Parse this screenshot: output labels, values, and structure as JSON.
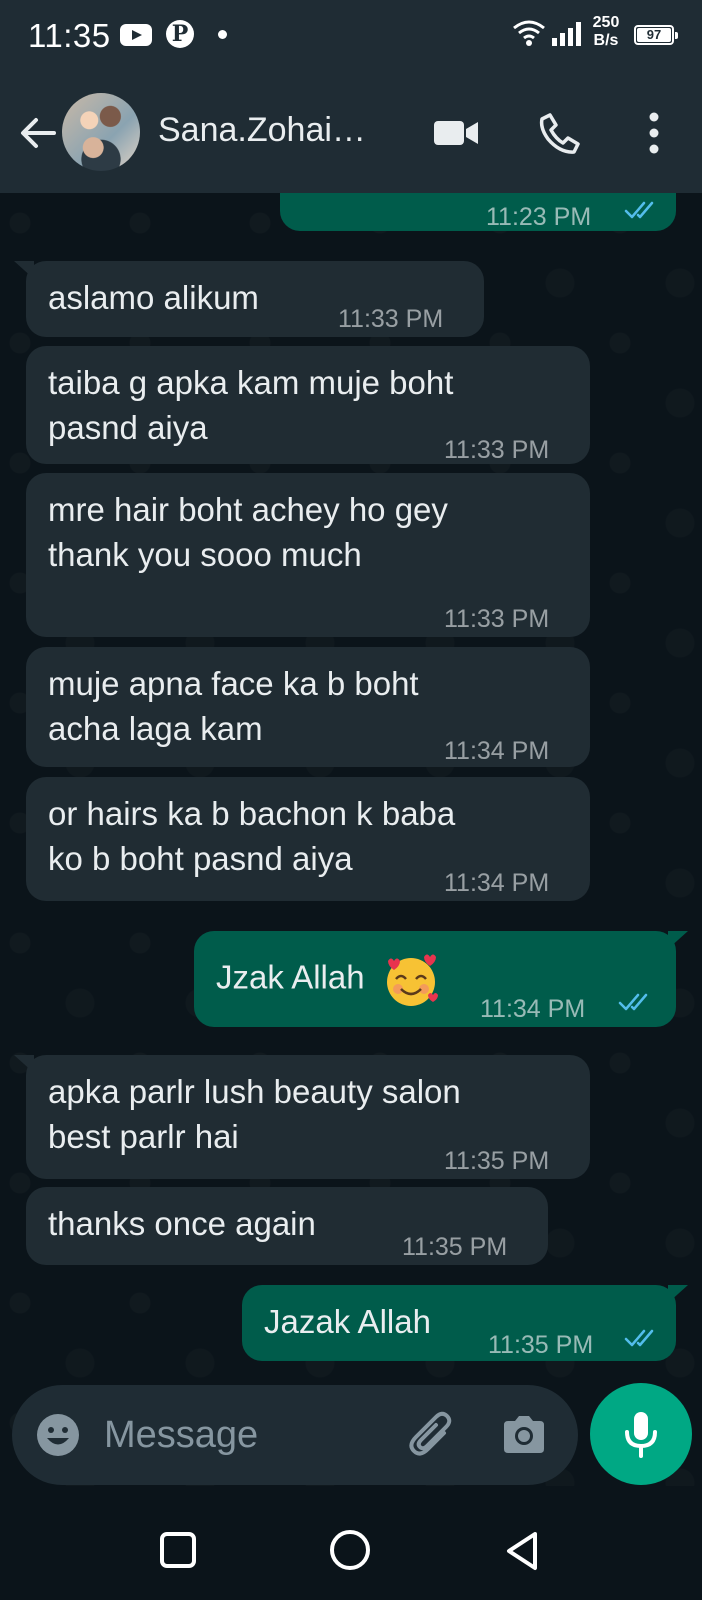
{
  "status_bar": {
    "time": "11:35",
    "net_speed_value": "250",
    "net_speed_unit": "B/s",
    "battery": "97",
    "icons": [
      "youtube-icon",
      "pinterest-icon",
      "notification-dot-icon",
      "wifi-icon",
      "signal-icon",
      "battery-icon"
    ]
  },
  "header": {
    "contact_name": "Sana.Zohai…",
    "icons": [
      "back-arrow-icon",
      "video-call-icon",
      "voice-call-icon",
      "more-options-icon"
    ]
  },
  "messages": [
    {
      "direction": "out",
      "text": "",
      "time": "11:23 PM",
      "status": "read"
    },
    {
      "direction": "in",
      "lines": [
        "aslamo alikum"
      ],
      "time": "11:33 PM"
    },
    {
      "direction": "in",
      "lines": [
        "taiba g apka kam muje boht",
        "pasnd aiya"
      ],
      "time": "11:33 PM"
    },
    {
      "direction": "in",
      "lines": [
        "mre hair boht achey ho gey",
        "thank you sooo much"
      ],
      "time": "11:33 PM"
    },
    {
      "direction": "in",
      "lines": [
        "muje apna face ka b boht",
        "acha laga kam"
      ],
      "time": "11:34 PM"
    },
    {
      "direction": "in",
      "lines": [
        "or hairs ka b bachon k baba",
        "ko b boht pasnd aiya"
      ],
      "time": "11:34 PM"
    },
    {
      "direction": "out",
      "lines": [
        "Jzak Allah"
      ],
      "emoji": "smiling-face-with-hearts-emoji",
      "time": "11:34 PM",
      "status": "read"
    },
    {
      "direction": "in",
      "lines": [
        "apka parlr lush beauty salon",
        "best parlr hai"
      ],
      "time": "11:35 PM"
    },
    {
      "direction": "in",
      "lines": [
        "thanks once again"
      ],
      "time": "11:35 PM"
    },
    {
      "direction": "out",
      "lines": [
        "Jazak Allah"
      ],
      "time": "11:35 PM",
      "status": "read"
    }
  ],
  "composer": {
    "placeholder": "Message",
    "value": "",
    "icons": [
      "emoji-icon",
      "attach-icon",
      "camera-icon",
      "mic-icon"
    ]
  },
  "colors": {
    "background": "#0b141a",
    "header": "#1f2c34",
    "incoming_bubble": "#202c33",
    "outgoing_bubble": "#005c4b",
    "accent": "#00a884",
    "read_ticks": "#53bdeb"
  }
}
